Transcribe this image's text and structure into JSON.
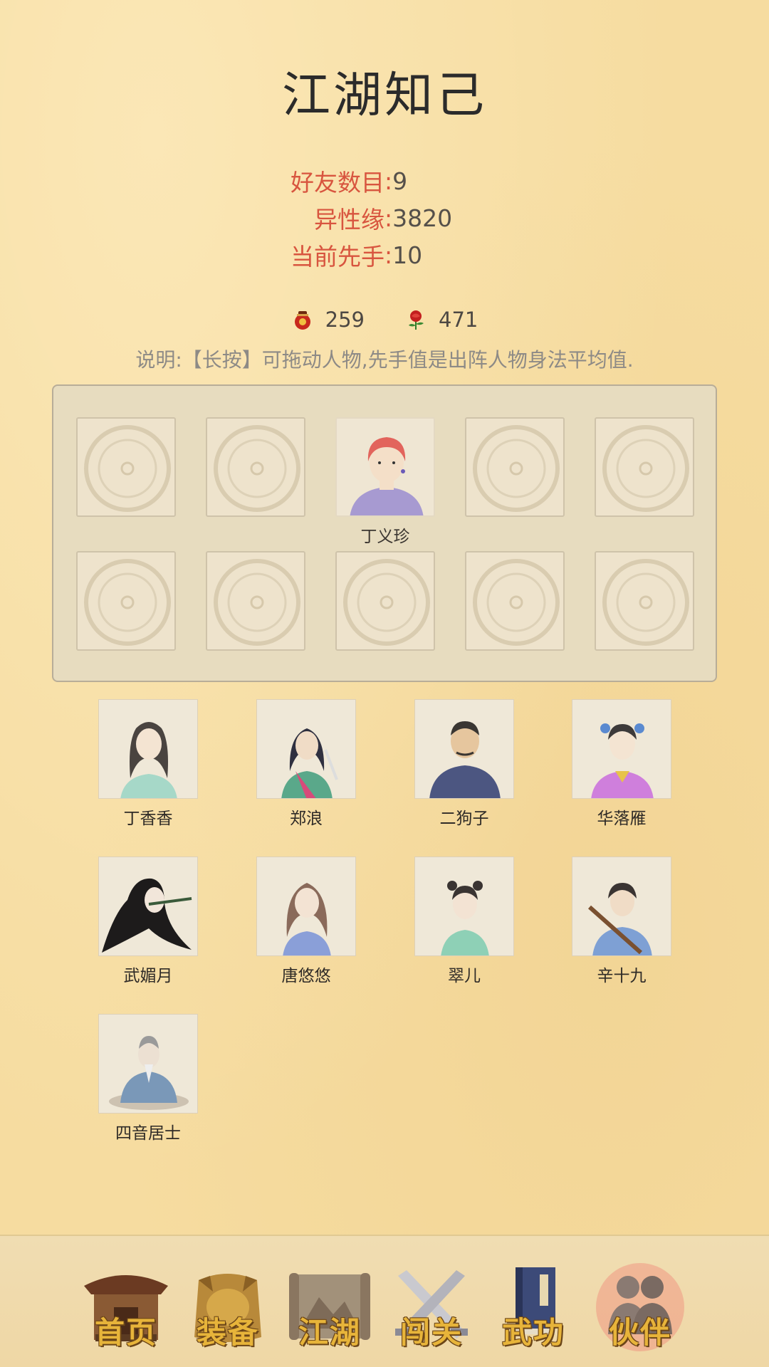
{
  "page": {
    "title": "江湖知己"
  },
  "stats": [
    {
      "label": "好友数目",
      "value": "9"
    },
    {
      "label": "异性缘",
      "value": "3820"
    },
    {
      "label": "当前先手",
      "value": "10"
    }
  ],
  "resources": [
    {
      "icon": "wine-jar-icon",
      "value": "259"
    },
    {
      "icon": "rose-icon",
      "value": "471"
    }
  ],
  "note": "说明:【长按】可拖动人物,先手值是出阵人物身法平均值.",
  "formation": {
    "filled_slot_name": "丁义珍"
  },
  "companions": [
    {
      "name": "丁香香"
    },
    {
      "name": "郑浪"
    },
    {
      "name": "二狗子"
    },
    {
      "name": "华落雁"
    },
    {
      "name": "武媚月"
    },
    {
      "name": "唐悠悠"
    },
    {
      "name": "翠儿"
    },
    {
      "name": "辛十九"
    },
    {
      "name": "四音居士"
    }
  ],
  "nav": [
    {
      "label": "首页",
      "icon": "house-icon"
    },
    {
      "label": "装备",
      "icon": "armor-icon"
    },
    {
      "label": "江湖",
      "icon": "scroll-map-icon"
    },
    {
      "label": "闯关",
      "icon": "crossed-swords-icon"
    },
    {
      "label": "武功",
      "icon": "book-icon"
    },
    {
      "label": "伙伴",
      "icon": "partners-icon",
      "active": true
    }
  ],
  "colors": {
    "accent": "#d8553f",
    "background": "#f6dca0",
    "nav_label": "#e7b43a"
  }
}
